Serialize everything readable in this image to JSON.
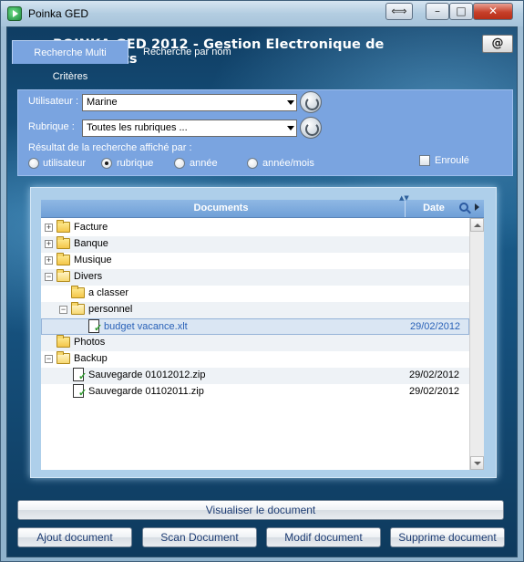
{
  "window": {
    "title": "Poinka GED",
    "swap_glyph": "⟺",
    "min_glyph": "–",
    "max_glyph": "□",
    "close_glyph": "✕"
  },
  "header": {
    "title": "POINKA GED 2012 - Gestion Electronique de Documents",
    "mail_glyph": "@"
  },
  "tabs": [
    {
      "label": "Recherche Multi Critères",
      "active": true
    },
    {
      "label": "Recherche par nom",
      "active": false
    }
  ],
  "filters": {
    "user_label": "Utilisateur :",
    "user_value": "Marine",
    "rubric_label": "Rubrique :",
    "rubric_value": "Toutes les rubriques ...",
    "display_label": "Résultat de la recherche affiché par :",
    "radios": [
      {
        "label": "utilisateur",
        "checked": false
      },
      {
        "label": "rubrique",
        "checked": true
      },
      {
        "label": "année",
        "checked": false
      },
      {
        "label": "année/mois",
        "checked": false
      }
    ],
    "enroule_label": "Enroulé",
    "enroule_checked": false
  },
  "list": {
    "col_documents": "Documents",
    "col_date": "Date",
    "sort_glyph": "▲▼",
    "rows": [
      {
        "name": "Facture",
        "date": "",
        "type": "folder",
        "level": 0,
        "expander": "+"
      },
      {
        "name": "Banque",
        "date": "",
        "type": "folder",
        "level": 0,
        "expander": "+"
      },
      {
        "name": "Musique",
        "date": "",
        "type": "folder",
        "level": 0,
        "expander": "+"
      },
      {
        "name": "Divers",
        "date": "",
        "type": "folder-open",
        "level": 0,
        "expander": "−"
      },
      {
        "name": "a classer",
        "date": "",
        "type": "folder",
        "level": 1,
        "expander": ""
      },
      {
        "name": "personnel",
        "date": "",
        "type": "folder-open",
        "level": 1,
        "expander": "−"
      },
      {
        "name": "budget vacance.xlt",
        "date": "29/02/2012",
        "type": "file",
        "level": 2,
        "expander": "",
        "selected": true
      },
      {
        "name": "Photos",
        "date": "",
        "type": "folder",
        "level": 0,
        "expander": ""
      },
      {
        "name": "Backup",
        "date": "",
        "type": "folder-open",
        "level": 0,
        "expander": "−"
      },
      {
        "name": "Sauvegarde 01012012.zip",
        "date": "29/02/2012",
        "type": "file",
        "level": 1,
        "expander": ""
      },
      {
        "name": "Sauvegarde 01102011.zip",
        "date": "29/02/2012",
        "type": "file",
        "level": 1,
        "expander": ""
      }
    ]
  },
  "buttons": {
    "view": "Visualiser le document",
    "add": "Ajout document",
    "scan": "Scan Document",
    "edit": "Modif document",
    "delete": "Supprime document"
  },
  "colors": {
    "panel": "#7aa4e0",
    "list_header": "#6f9fd7",
    "selected_text": "#2a62b8"
  }
}
